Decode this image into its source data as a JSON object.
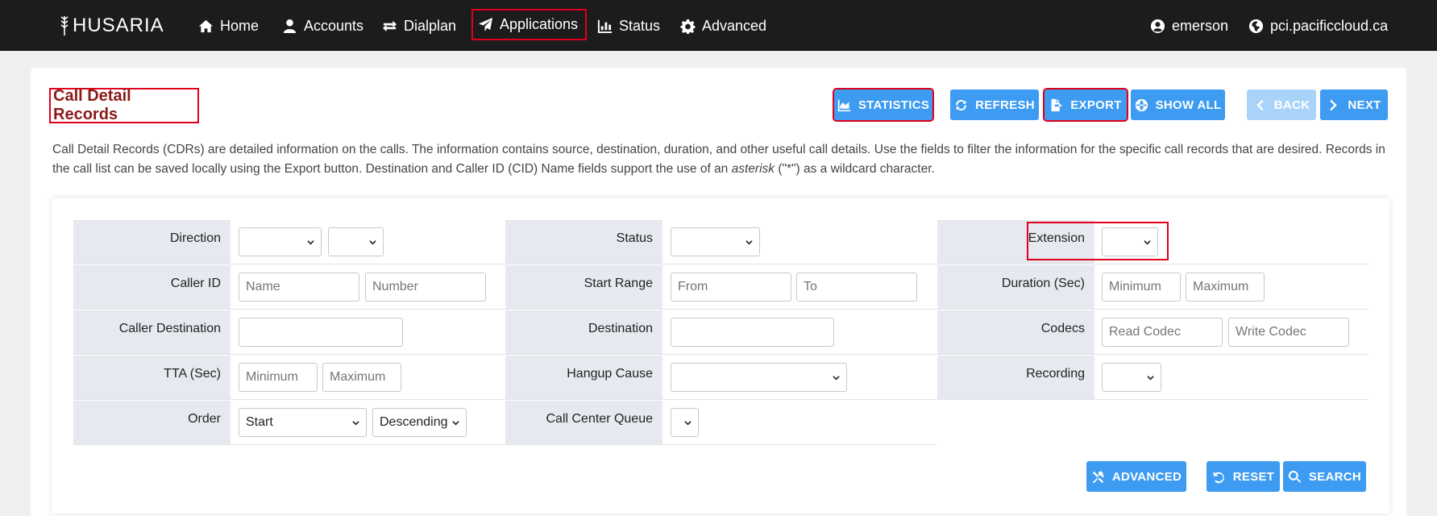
{
  "nav": {
    "brand": "HUSARIA",
    "items": [
      {
        "label": "Home",
        "icon": "home-icon"
      },
      {
        "label": "Accounts",
        "icon": "user-icon"
      },
      {
        "label": "Dialplan",
        "icon": "exchange-icon"
      },
      {
        "label": "Applications",
        "icon": "paper-plane-icon"
      },
      {
        "label": "Status",
        "icon": "bar-chart-icon"
      },
      {
        "label": "Advanced",
        "icon": "gear-icon"
      }
    ],
    "user": "emerson",
    "domain": "pci.pacificcloud.ca"
  },
  "page": {
    "title": "Call Detail Records",
    "description_1": "Call Detail Records (CDRs) are detailed information on the calls. The information contains source, destination, duration, and other useful call details. Use the fields to filter the information for the specific call records that are desired. Records in the call list can be saved locally using the Export button.   Destination and Caller ID (CID) Name fields support the use of an ",
    "description_em": "asterisk",
    "description_2": " (\"*\") as a wildcard character."
  },
  "toolbar": {
    "statistics": "STATISTICS",
    "refresh": "REFRESH",
    "export": "EXPORT",
    "show_all": "SHOW ALL",
    "back": "BACK",
    "next": "NEXT"
  },
  "filters": {
    "direction": "Direction",
    "status": "Status",
    "extension": "Extension",
    "caller_id": "Caller ID",
    "caller_id_name_ph": "Name",
    "caller_id_number_ph": "Number",
    "start_range": "Start Range",
    "start_from_ph": "From",
    "start_to_ph": "To",
    "duration": "Duration (Sec)",
    "duration_min_ph": "Minimum",
    "duration_max_ph": "Maximum",
    "caller_destination": "Caller Destination",
    "destination": "Destination",
    "codecs": "Codecs",
    "read_codec_ph": "Read Codec",
    "write_codec_ph": "Write Codec",
    "tta": "TTA (Sec)",
    "tta_min_ph": "Minimum",
    "tta_max_ph": "Maximum",
    "hangup_cause": "Hangup Cause",
    "recording": "Recording",
    "order": "Order",
    "order_field_value": "Start",
    "order_dir_value": "Descending",
    "call_center_queue": "Call Center Queue"
  },
  "actions": {
    "advanced": "ADVANCED",
    "reset": "RESET",
    "search": "SEARCH"
  },
  "colors": {
    "accent": "#3d9bf2",
    "highlight": "#e0001b",
    "title": "#8b1a1a"
  }
}
